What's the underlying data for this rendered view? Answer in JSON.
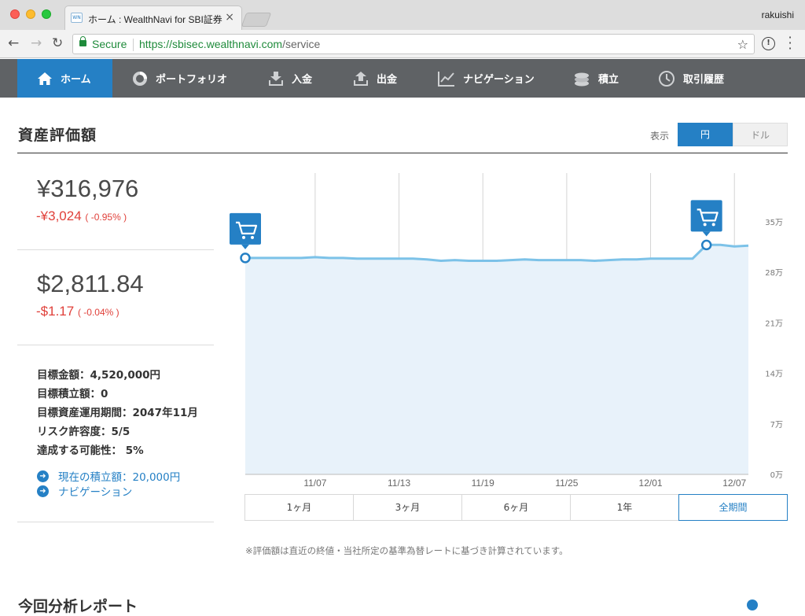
{
  "browser": {
    "tab_title": "ホーム : WealthNavi for SBI証券",
    "tab_favicon": "WN",
    "tab_close": "×",
    "user": "rakuishi",
    "secure_label": "Secure",
    "url_scheme_host": "https://sbisec.wealthnavi.com",
    "url_path": "/service"
  },
  "nav": {
    "items": [
      {
        "label": "ホーム",
        "icon": "home-icon"
      },
      {
        "label": "ポートフォリオ",
        "icon": "donut-icon"
      },
      {
        "label": "入金",
        "icon": "deposit-icon"
      },
      {
        "label": "出金",
        "icon": "withdraw-icon"
      },
      {
        "label": "ナビゲーション",
        "icon": "line-chart-icon"
      },
      {
        "label": "積立",
        "icon": "coins-icon"
      },
      {
        "label": "取引履歴",
        "icon": "clock-icon"
      }
    ]
  },
  "summary": {
    "title": "資産評価額",
    "display_label": "表示",
    "currency_yen": "円",
    "currency_usd": "ドル",
    "yen_value": "¥316,976",
    "yen_change": "-¥3,024",
    "yen_change_pct": "( -0.95% )",
    "usd_value": "$2,811.84",
    "usd_change": "-$1.17",
    "usd_change_pct": "( -0.04% )"
  },
  "goals": {
    "target_amount": "目標金額：4,520,000円",
    "target_monthly": "目標積立額：0",
    "target_period": "目標資産運用期間：2047年11月",
    "risk": "リスク許容度：5/5",
    "probability": "達成する可能性： 5%",
    "link_current": "現在の積立額：20,000円",
    "link_navigation": "ナビゲーション"
  },
  "ranges": {
    "r1": "1ヶ月",
    "r3": "3ヶ月",
    "r6": "6ヶ月",
    "r12": "1年",
    "all": "全期間"
  },
  "note": "※評価額は直近の終値・当社所定の基準為替レートに基づき計算されています。",
  "next_heading": "今回分析レポート",
  "colors": {
    "accent": "#2580c5",
    "nav_bg": "#5f6265",
    "negative": "#e0403a",
    "line": "#7cc2e8",
    "area": "#e8f2fa"
  },
  "chart_data": {
    "type": "area",
    "y_unit": "万",
    "ylim": [
      0,
      35
    ],
    "yticks": [
      0,
      7,
      14,
      21,
      28,
      35
    ],
    "ytick_labels": [
      "0万",
      "7万",
      "14万",
      "21万",
      "28万",
      "35万"
    ],
    "xtick_labels": [
      "11/07",
      "11/13",
      "11/19",
      "11/25",
      "12/01",
      "12/07"
    ],
    "x_index_of_ticks": [
      5,
      11,
      17,
      23,
      29,
      35
    ],
    "values": [
      30.0,
      30.0,
      30.0,
      30.0,
      30.0,
      30.1,
      30.0,
      30.0,
      29.9,
      29.9,
      29.9,
      29.9,
      29.9,
      29.8,
      29.6,
      29.7,
      29.6,
      29.6,
      29.6,
      29.7,
      29.8,
      29.7,
      29.7,
      29.7,
      29.7,
      29.6,
      29.7,
      29.8,
      29.8,
      29.9,
      29.9,
      29.9,
      29.9,
      31.8,
      31.8,
      31.6,
      31.7
    ],
    "purchase_markers": [
      0,
      33
    ],
    "grid": true
  }
}
